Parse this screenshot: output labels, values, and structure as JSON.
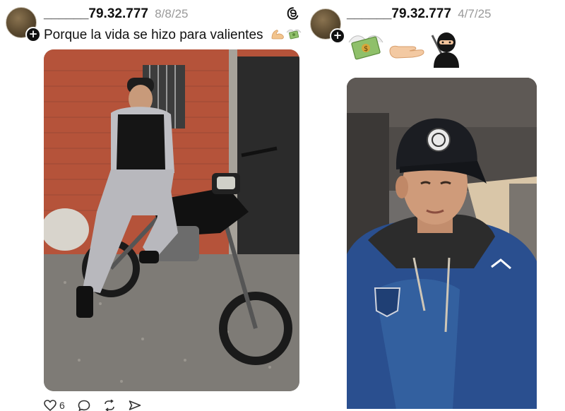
{
  "posts": [
    {
      "username": "______79.32.777",
      "date": "8/8/25",
      "caption": "Porque la vida se hizo para valientes",
      "caption_emojis": [
        "flexed-biceps-emoji",
        "money-with-wings-emoji"
      ],
      "has_threads_logo": true,
      "actions": {
        "like_count": "6",
        "like_icon": "heart-icon",
        "comment_icon": "comment-icon",
        "repost_icon": "repost-icon",
        "share_icon": "share-icon"
      }
    },
    {
      "username": "______79.32.777",
      "date": "4/7/25",
      "emojis": [
        "money-with-wings-emoji",
        "palm-up-hand-emoji",
        "ninja-emoji"
      ]
    }
  ],
  "colors": {
    "username": "#111111",
    "date": "#9a9a9a",
    "brick": "#b5533a",
    "jacket": "#2a4f8f"
  }
}
